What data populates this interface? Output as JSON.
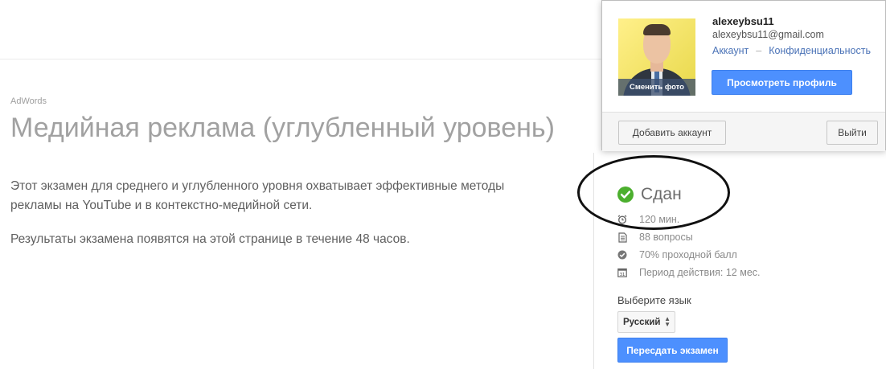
{
  "breadcrumb": "AdWords",
  "page_title": "Медийная реклама (углубленный уровень)",
  "description": "Этот экзамен для среднего и углубленного уровня охватывает эффективные методы рекламы на YouTube и в контекстно-медийной сети.",
  "results_note": "Результаты экзамена появятся на этой странице в течение 48 часов.",
  "exam": {
    "status": "Сдан",
    "status_color": "#4caf2e",
    "facts": [
      {
        "icon": "alarm-clock-icon",
        "text": "120 мин."
      },
      {
        "icon": "document-icon",
        "text": "88 вопросы"
      },
      {
        "icon": "check-circle-icon",
        "text": "70% проходной балл"
      },
      {
        "icon": "calendar-icon",
        "text": "Период действия: 12 мес."
      }
    ],
    "language_label": "Выберите язык",
    "language_value": "Русский",
    "retake_label": "Пересдать экзамен",
    "accent_color": "#4d90fe"
  },
  "account_popup": {
    "username": "alexeybsu11",
    "email": "alexeybsu11@gmail.com",
    "link_account": "Аккаунт",
    "link_separator": "–",
    "link_privacy": "Конфиденциальность",
    "change_photo": "Сменить фото",
    "view_profile": "Просмотреть профиль",
    "add_account": "Добавить аккаунт",
    "sign_out": "Выйти"
  }
}
